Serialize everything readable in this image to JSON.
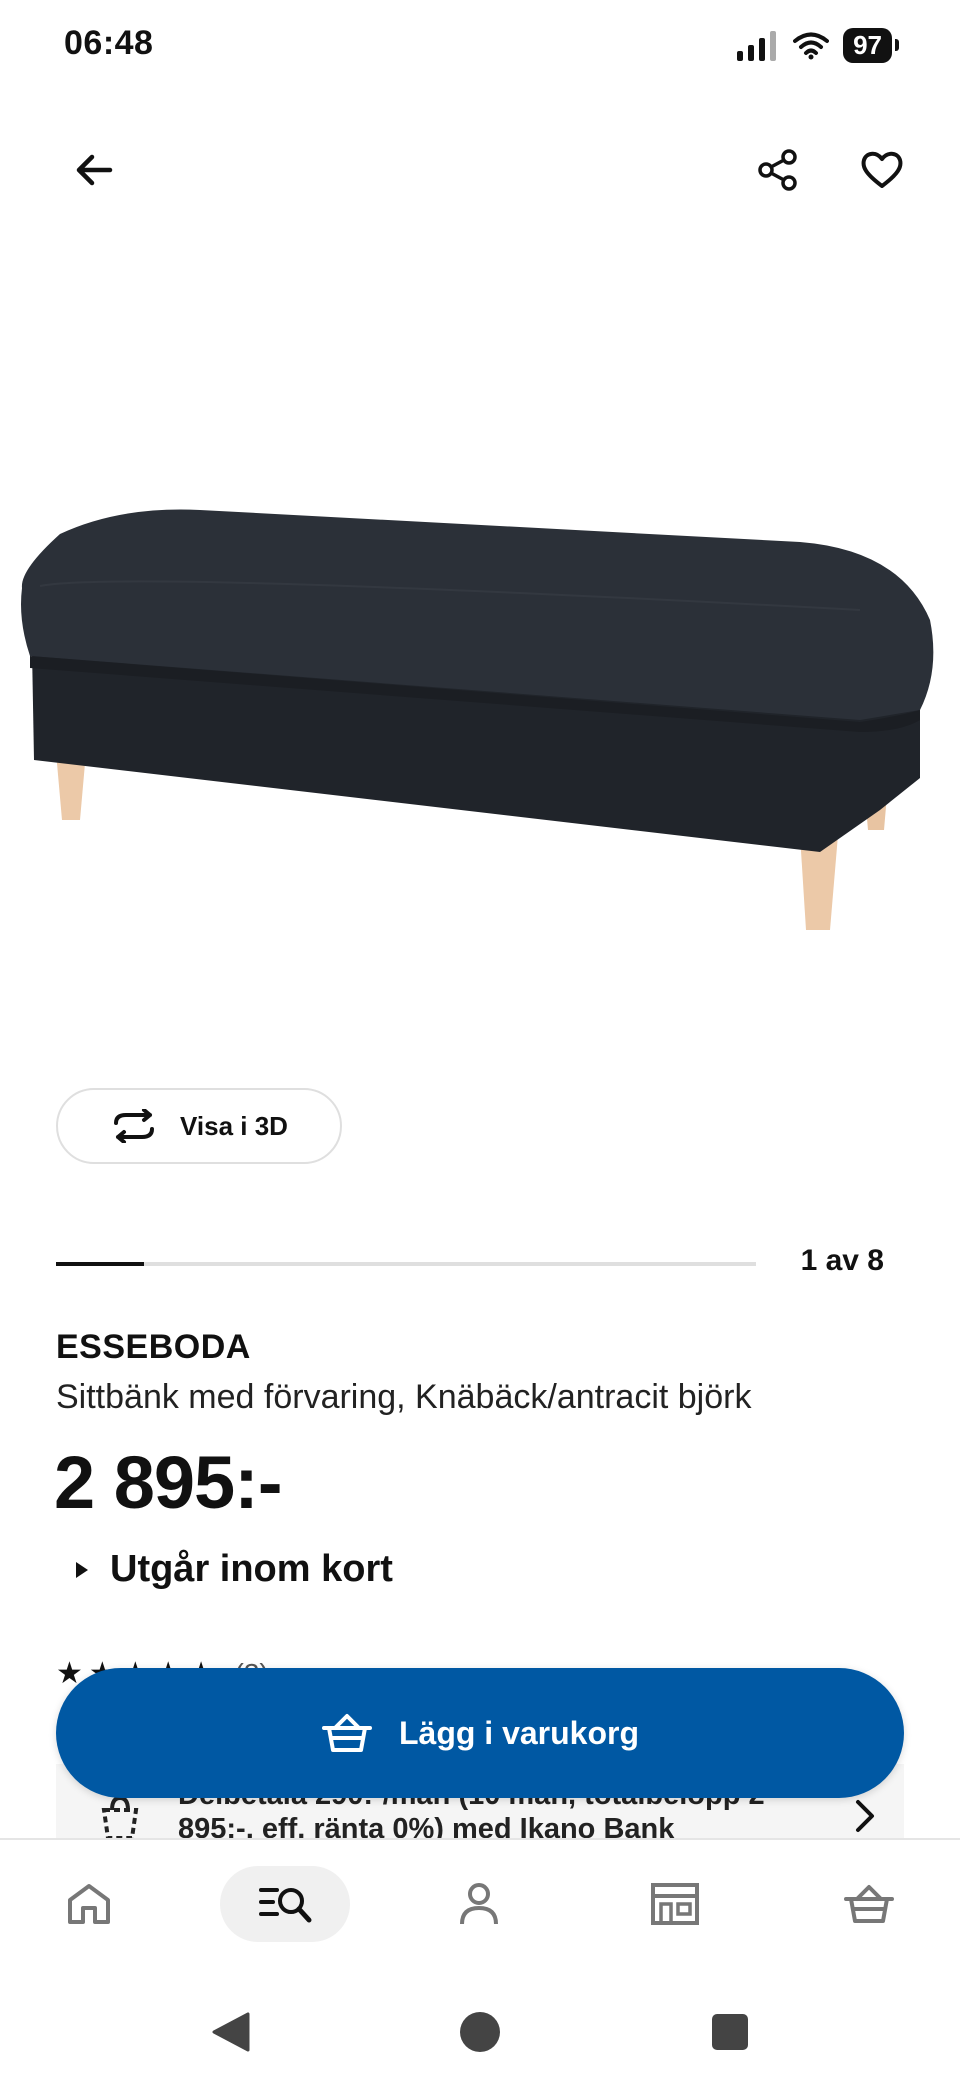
{
  "status_bar": {
    "time": "06:48",
    "battery": "97"
  },
  "top_bar": {
    "back_icon": "arrow-left-icon",
    "share_icon": "share-icon",
    "favorite_icon": "heart-icon"
  },
  "product_image": {
    "icon": "storage-bench-image"
  },
  "view_3d": {
    "label": "Visa i 3D",
    "icon": "rotate-3d-icon"
  },
  "gallery": {
    "counter": "1 av 8",
    "progress": 0.125
  },
  "product": {
    "name": "ESSEBODA",
    "description": "Sittbänk med förvaring, Knäbäck/antracit björk",
    "price": "2 895:-",
    "stock_status": "Utgår inom kort",
    "rating_count": "(3)"
  },
  "finance": {
    "text": "Delbetala 290:-/mån (10 mån, totalbelopp 2 895:-, eff. ränta 0%) med Ikano Bank"
  },
  "add_to_cart": {
    "label": "Lägg i varukorg",
    "icon": "basket-icon"
  },
  "bottom_nav": {
    "items": [
      "home-icon",
      "search-list-icon",
      "profile-icon",
      "store-icon",
      "cart-icon"
    ],
    "active": "search-list-icon"
  },
  "colors": {
    "primary": "#0058a3",
    "text": "#111111",
    "track": "#dfdfdf",
    "bench_fabric": "#262a31",
    "bench_legs": "#ecc9a8"
  }
}
